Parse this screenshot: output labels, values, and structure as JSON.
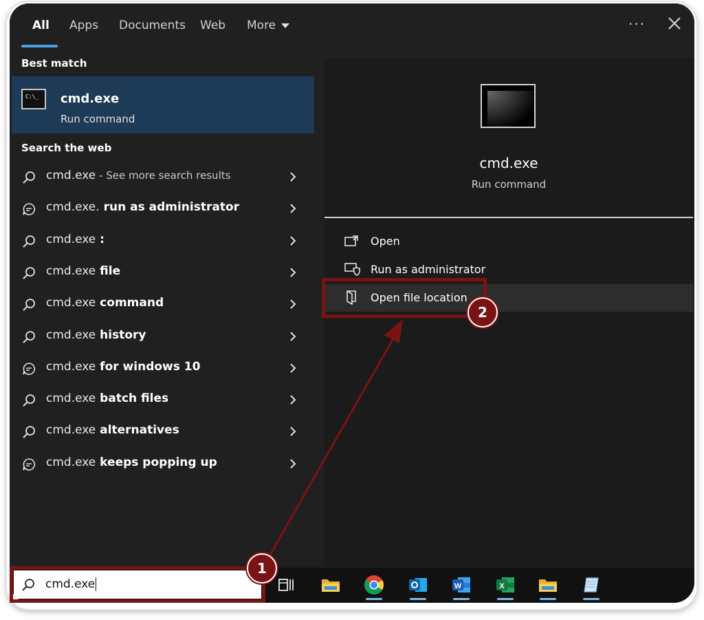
{
  "tabs": [
    {
      "label": "All",
      "active": true
    },
    {
      "label": "Apps",
      "active": false
    },
    {
      "label": "Documents",
      "active": false
    },
    {
      "label": "Web",
      "active": false
    },
    {
      "label": "More",
      "active": false
    }
  ],
  "header": {
    "more_options": "···",
    "close_icon": "close-icon"
  },
  "best_match": {
    "heading": "Best match",
    "title": "cmd.exe",
    "subtitle": "Run command",
    "icon": "command-prompt-icon"
  },
  "web": {
    "heading": "Search the web",
    "items": [
      {
        "icon": "search-icon",
        "base": "cmd.exe",
        "bold": "",
        "suffix": " - See more search results"
      },
      {
        "icon": "chat-bubble-icon",
        "base": "cmd.exe.",
        "bold": " run as administrator",
        "suffix": ""
      },
      {
        "icon": "search-icon",
        "base": "cmd.exe",
        "bold": " :",
        "suffix": ""
      },
      {
        "icon": "search-icon",
        "base": "cmd.exe",
        "bold": " file",
        "suffix": ""
      },
      {
        "icon": "search-icon",
        "base": "cmd.exe",
        "bold": " command",
        "suffix": ""
      },
      {
        "icon": "search-icon",
        "base": "cmd.exe",
        "bold": " history",
        "suffix": ""
      },
      {
        "icon": "chat-bubble-icon",
        "base": "cmd.exe",
        "bold": " for windows 10",
        "suffix": ""
      },
      {
        "icon": "search-icon",
        "base": "cmd.exe",
        "bold": " batch files",
        "suffix": ""
      },
      {
        "icon": "search-icon",
        "base": "cmd.exe",
        "bold": " alternatives",
        "suffix": ""
      },
      {
        "icon": "chat-bubble-icon",
        "base": "cmd.exe",
        "bold": " keeps popping up",
        "suffix": ""
      }
    ]
  },
  "details": {
    "title": "cmd.exe",
    "subtitle": "Run command",
    "actions": [
      {
        "label": "Open",
        "icon": "open-window-icon"
      },
      {
        "label": "Run as administrator",
        "icon": "shield-window-icon"
      },
      {
        "label": "Open file location",
        "icon": "folder-location-icon"
      }
    ]
  },
  "taskbar": {
    "search_value": "cmd.exe",
    "apps": [
      "task-view-icon",
      "file-explorer-icon",
      "chrome-icon",
      "outlook-icon",
      "word-icon",
      "excel-icon",
      "file-explorer-icon",
      "notepad-icon"
    ]
  },
  "annotations": {
    "step1": "1",
    "step2": "2",
    "color": "#7a1313"
  },
  "colors": {
    "accent": "#4ca0e0",
    "selected_bg": "#1d3a57",
    "panel_bg": "#202020"
  }
}
